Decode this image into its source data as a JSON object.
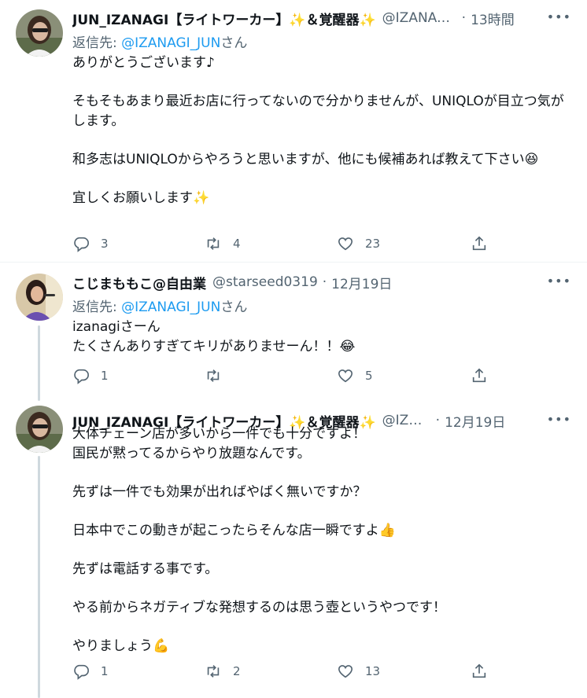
{
  "tweets": [
    {
      "name": "JUN_IZANAGI【ライトワーカー】✨＆覚醒器✨",
      "handle": "@IZANAGI_JUN",
      "time": "13時間",
      "reply_prefix": "返信先: ",
      "reply_to": "@IZANAGI_JUN",
      "reply_suffix": "さん",
      "text": "ありがとうございます♪\n\nそもそもあまり最近お店に行ってないので分かりませんが、UNIQLOが目立つ気がします。\n\n和多志はUNIQLOからやろうと思いますが、他にも候補あれば教えて下さい😆\n\n宜しくお願いします✨",
      "replies": "3",
      "retweets": "4",
      "likes": "23"
    },
    {
      "name": "こじまももこ@自由業",
      "handle": "@starseed0319",
      "time": "12月19日",
      "reply_prefix": "返信先: ",
      "reply_to": "@IZANAGI_JUN",
      "reply_suffix": "さん",
      "text": "izanagiさーん\nたくさんありすぎてキリがありませーん！！😂",
      "replies": "1",
      "retweets": "",
      "likes": "5"
    },
    {
      "name": "JUN_IZANAGI【ライトワーカー】✨＆覚醒器✨",
      "handle": "@IZANAGI_JUN",
      "time": "12月19日",
      "text": "大体チェーン店が多いから一件でも十分ですよ！\n国民が黙ってるからやり放題なんです。\n\n先ずは一件でも効果が出ればやばく無いですか？\n\n日本中でこの動きが起こったらそんな店一瞬ですよ👍\n\n先ずは電話する事です。\n\nやる前からネガティブな発想するのは思う壺というやつです！\n\nやりましょう💪",
      "replies": "1",
      "retweets": "2",
      "likes": "13"
    }
  ],
  "separator": "·",
  "more_icon": "more-horizontal-icon",
  "colors": {
    "link": "#1d9bf0",
    "secondary": "#536471",
    "text": "#0f1419",
    "thread_line": "#cfd9de"
  }
}
